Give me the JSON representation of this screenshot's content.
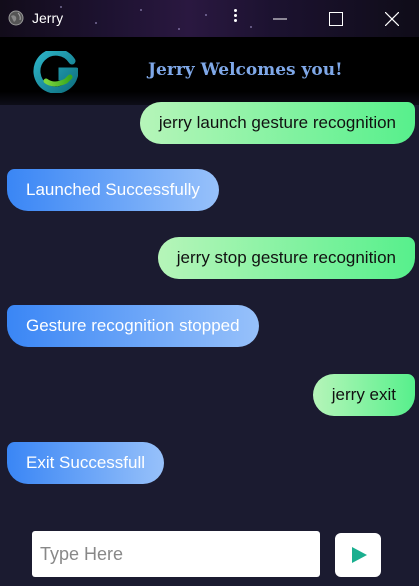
{
  "window": {
    "title": "Jerry",
    "minimize_icon": "minimize-icon",
    "maximize_icon": "maximize-icon",
    "close_icon": "close-icon"
  },
  "header": {
    "logo_icon": "g-logo-icon",
    "title": "Jerry Welcomes you!",
    "title_color": "#7fa8e8"
  },
  "messages": [
    {
      "sender": "user",
      "text": "jerry launch gesture recognition"
    },
    {
      "sender": "bot",
      "text": "Launched Successfully"
    },
    {
      "sender": "user",
      "text": "jerry stop gesture recognition"
    },
    {
      "sender": "bot",
      "text": "Gesture recognition stopped"
    },
    {
      "sender": "user",
      "text": "jerry exit"
    },
    {
      "sender": "bot",
      "text": "Exit Successfull"
    }
  ],
  "input": {
    "placeholder": "Type Here",
    "value": ""
  },
  "send_button": {
    "icon": "send-play-icon",
    "color": "#1aaf8f"
  },
  "colors": {
    "background": "#1b1b30",
    "user_bubble_start": "#b6f5b9",
    "user_bubble_end": "#57f08c",
    "bot_bubble_start": "#3a86f5",
    "bot_bubble_end": "#97c1fa"
  }
}
